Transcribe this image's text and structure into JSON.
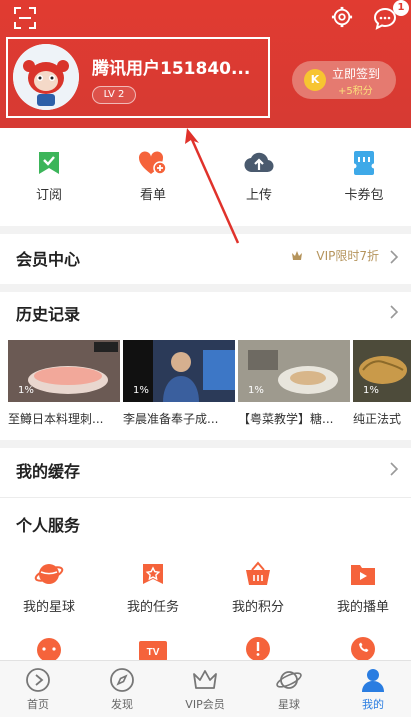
{
  "header": {
    "message_badge": "1",
    "username": "腾讯用户151840...",
    "level": "LV 2",
    "checkin": {
      "coin_letter": "K",
      "title": "立即签到",
      "reward": "+5积分"
    }
  },
  "quick_actions": [
    {
      "label": "订阅",
      "icon": "subscribe-icon"
    },
    {
      "label": "看单",
      "icon": "watchlist-icon"
    },
    {
      "label": "上传",
      "icon": "upload-icon"
    },
    {
      "label": "卡券包",
      "icon": "coupon-icon"
    }
  ],
  "member_center": {
    "title": "会员中心",
    "promo": "VIP限时7折"
  },
  "history": {
    "title": "历史记录",
    "items": [
      {
        "progress": "1%",
        "caption": "至鳟日本料理刺..."
      },
      {
        "progress": "1%",
        "caption": "李晨准备奉子成..."
      },
      {
        "progress": "1%",
        "caption": "【粤菜教学】糖..."
      },
      {
        "progress": "1%",
        "caption": "纯正法式"
      }
    ]
  },
  "cache": {
    "title": "我的缓存"
  },
  "services": {
    "title": "个人服务",
    "items": [
      {
        "label": "我的星球",
        "icon": "planet-icon"
      },
      {
        "label": "我的任务",
        "icon": "task-icon"
      },
      {
        "label": "我的积分",
        "icon": "points-basket-icon"
      },
      {
        "label": "我的播单",
        "icon": "playlist-icon"
      }
    ],
    "second_row_icons": [
      {
        "icon": "face-icon"
      },
      {
        "icon": "tv-icon",
        "text": "TV"
      },
      {
        "icon": "alert-icon"
      },
      {
        "icon": "phone-icon"
      }
    ]
  },
  "tabbar": [
    {
      "label": "首页",
      "icon": "home-play-icon"
    },
    {
      "label": "发现",
      "icon": "compass-icon"
    },
    {
      "label": "VIP会员",
      "icon": "crown-icon"
    },
    {
      "label": "星球",
      "icon": "planet-tab-icon"
    },
    {
      "label": "我的",
      "icon": "profile-icon",
      "active": true
    }
  ],
  "colors": {
    "header_red": "#e13b31",
    "accent_orange": "#f5633b",
    "green": "#3cb55a",
    "blue": "#2a7de1",
    "vip_gold": "#b5945c"
  }
}
